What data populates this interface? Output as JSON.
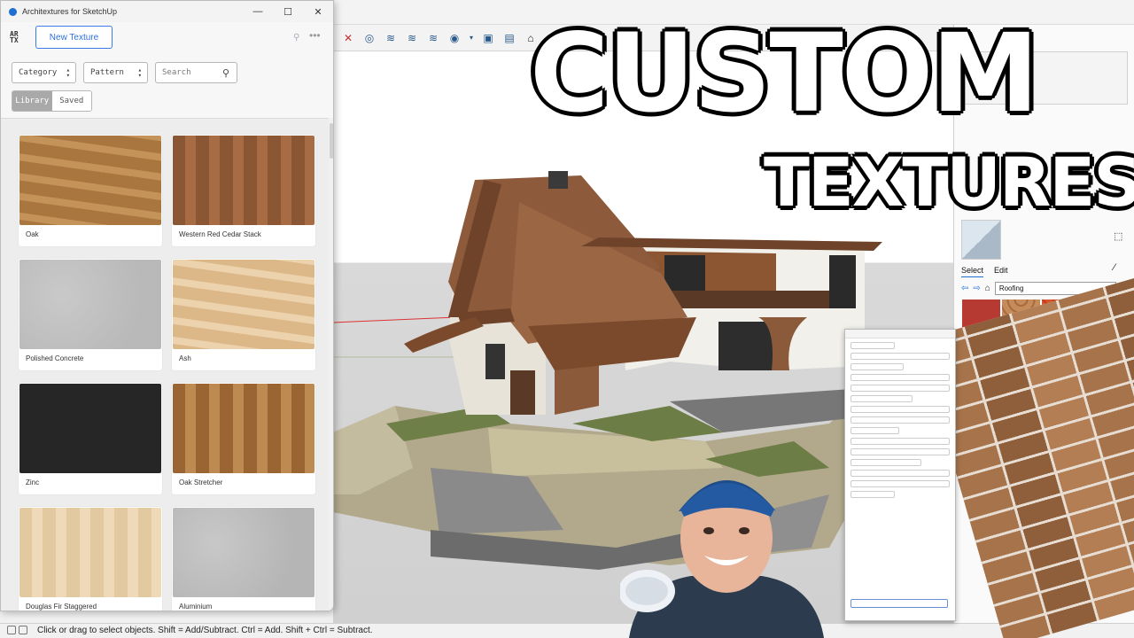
{
  "plugin": {
    "window_title": "Architextures for SketchUp",
    "window_controls": [
      "—",
      "☐",
      "✕"
    ],
    "logo_text_top": "AR",
    "logo_text_bottom": "TX",
    "new_texture_label": "New Texture",
    "filters": {
      "category_label": "Category",
      "pattern_label": "Pattern",
      "search_placeholder": "Search"
    },
    "tabs": [
      {
        "label": "Library",
        "active": true
      },
      {
        "label": "Saved",
        "active": false
      }
    ],
    "textures": [
      {
        "name": "Oak",
        "color_a": "#a9763f",
        "color_b": "#c49359",
        "style": "wood"
      },
      {
        "name": "Western Red Cedar Stack",
        "color_a": "#8a5634",
        "color_b": "#a86c45",
        "style": "planks"
      },
      {
        "name": "Polished Concrete",
        "color_a": "#b9b9b9",
        "color_b": "#c9c9c9",
        "style": "concrete"
      },
      {
        "name": "Ash",
        "color_a": "#dcb889",
        "color_b": "#ecd2ad",
        "style": "wood"
      },
      {
        "name": "Zinc",
        "color_a": "#262626",
        "color_b": "#333333",
        "style": "flat"
      },
      {
        "name": "Oak Stretcher",
        "color_a": "#9a6533",
        "color_b": "#bd8a52",
        "style": "planks"
      },
      {
        "name": "Douglas Fir Staggered",
        "color_a": "#e3c9a0",
        "color_b": "#eedab8",
        "style": "planks"
      },
      {
        "name": "Aluminium",
        "color_a": "#b5b5b5",
        "color_b": "#c8c8c8",
        "style": "concrete"
      }
    ]
  },
  "sketchup": {
    "status_text": "Click or drag to select objects. Shift = Add/Subtract. Ctrl = Add. Shift + Ctrl = Subtract.",
    "tray": {
      "tab_select": "Select",
      "tab_edit": "Edit",
      "collection": "Roofing",
      "swatches": [
        "#b73a32",
        "#c68b5a",
        "#d9542c",
        "#7c6f66",
        "#9a8f86",
        "#8b7d73"
      ]
    }
  },
  "headline": {
    "line1": "CUSTOM",
    "line2": "TEXTURES!"
  },
  "colors": {
    "accent": "#2e6fdc",
    "tab_active_bg": "#a9a9a9"
  }
}
